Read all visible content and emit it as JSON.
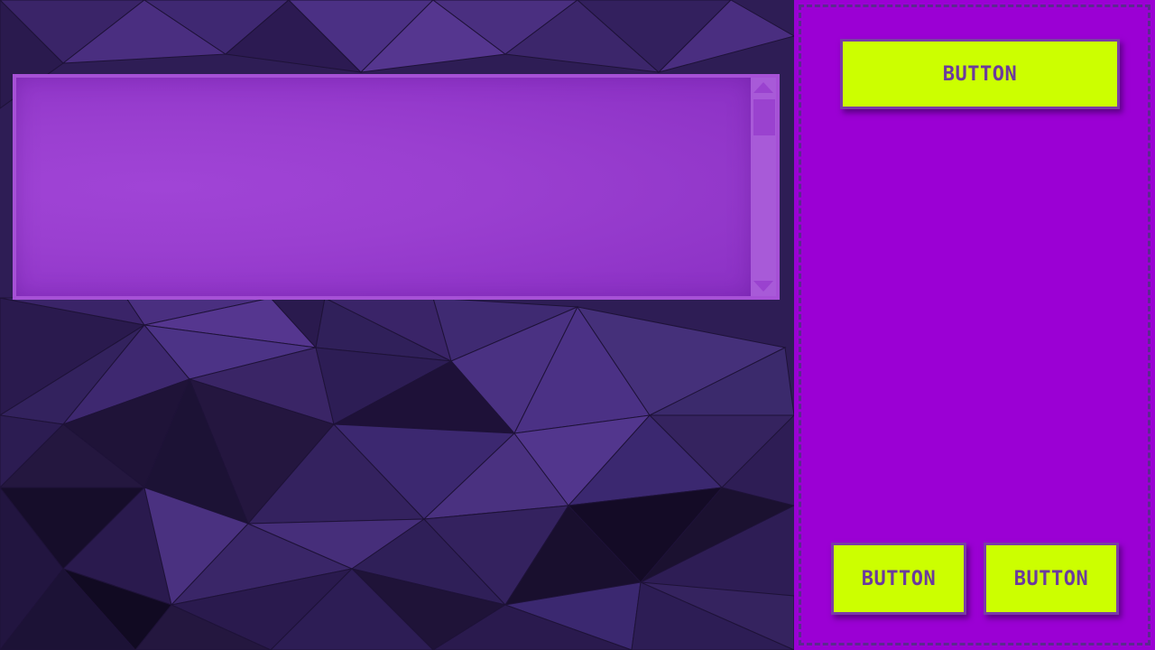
{
  "theme": {
    "background": "#2a1a4e",
    "panel_purple": "#9b00d4",
    "text_area_purple": "#a044d6",
    "button_lime": "#ccff00",
    "button_text": "#6b3a9e",
    "dashed_border": "#5a2a8e"
  },
  "text_panel": {
    "content": "",
    "scrollbar": {
      "up_icon": "triangle-up-icon",
      "down_icon": "triangle-down-icon"
    }
  },
  "side_panel": {
    "buttons": {
      "top_label": "BUTTON",
      "bottom_left_label": "BUTTON",
      "bottom_right_label": "BUTTON"
    }
  }
}
